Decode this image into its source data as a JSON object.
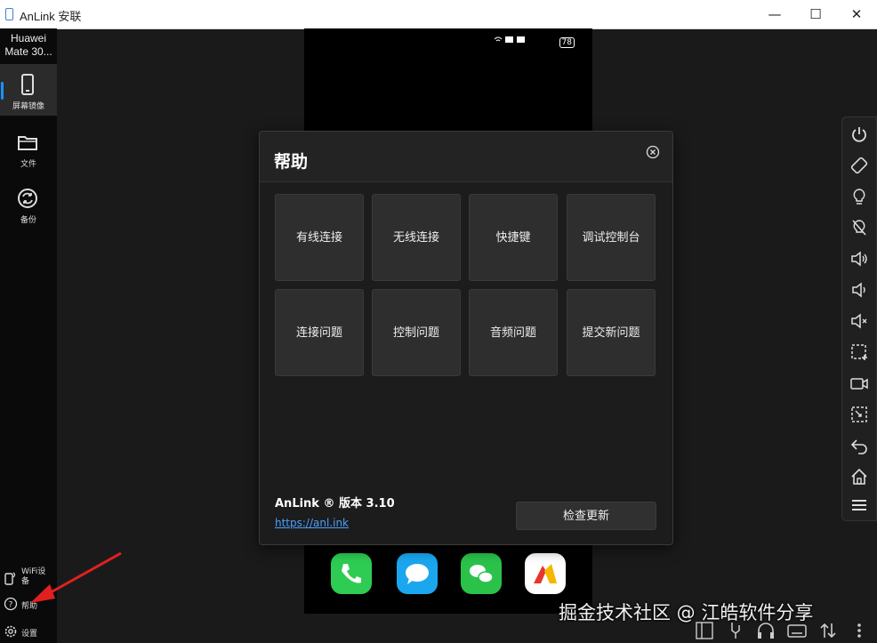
{
  "window": {
    "title": "AnLink 安联",
    "minimize_glyph": "—",
    "maximize_glyph": "☐",
    "close_glyph": "✕"
  },
  "sidebar": {
    "device_name": "Huawei Mate 30...",
    "items": [
      {
        "label": "屏幕镜像",
        "icon": "phone-icon"
      },
      {
        "label": "文件",
        "icon": "folder-icon"
      },
      {
        "label": "备份",
        "icon": "sync-icon"
      }
    ],
    "bottom": [
      {
        "label": "WiFi设备",
        "icon": "wifi-device-icon"
      },
      {
        "label": "帮助",
        "icon": "help-icon"
      },
      {
        "label": "设置",
        "icon": "gear-icon"
      }
    ]
  },
  "dialog": {
    "title": "帮助",
    "tiles": [
      "有线连接",
      "无线连接",
      "快捷键",
      "调试控制台",
      "连接问题",
      "控制问题",
      "音频问题",
      "提交新问题"
    ],
    "version": "AnLink ® 版本 3.10",
    "link": "https://anl.ink",
    "update_button": "检查更新"
  },
  "phone": {
    "battery": "78"
  },
  "toolbar": {
    "icons": [
      "power-icon",
      "rotate-icon",
      "light-on-icon",
      "light-off-icon",
      "volume-up-icon",
      "volume-down-icon",
      "mute-icon",
      "screenshot-icon",
      "record-icon",
      "crop-icon",
      "back-icon",
      "home-icon",
      "menu-icon"
    ]
  },
  "watermark": "掘金技术社区 @ 江皓软件分享",
  "colors": {
    "accent": "#1e90ff",
    "link": "#4aa0ff",
    "arrow": "#e02020"
  }
}
